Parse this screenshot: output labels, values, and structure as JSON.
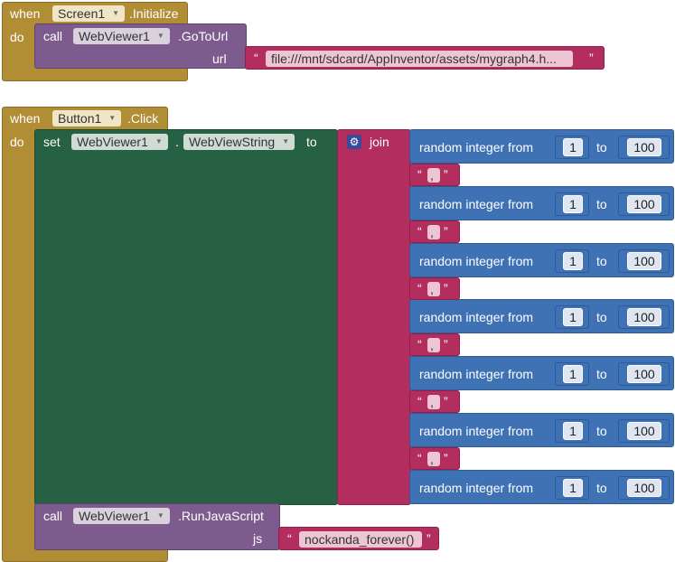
{
  "init_block": {
    "when": "when",
    "component": "Screen1",
    "event": ".Initialize",
    "do": "do",
    "call": "call",
    "target": "WebViewer1",
    "method": ".GoToUrl",
    "arg_label": "url",
    "url_value": "file:///mnt/sdcard/AppInventor/assets/mygraph4.h...",
    "open_quote": "“",
    "close_quote": "”"
  },
  "click_block": {
    "when": "when",
    "component": "Button1",
    "event": ".Click",
    "do": "do",
    "set": "set",
    "target": "WebViewer1",
    "dot": ".",
    "property": "WebViewString",
    "to": "to",
    "join": "join",
    "random_label": "random integer from",
    "from_value": "1",
    "to_label": "to",
    "to_value": "100",
    "separator": ",",
    "open_quote": "“",
    "close_quote": "”",
    "call": "call",
    "js_target": "WebViewer1",
    "js_method": ".RunJavaScript",
    "js_label": "js",
    "js_value": "nockanda_forever()"
  },
  "icons": {
    "dropdown": "dropdown-triangle-icon",
    "mutator": "gear-icon"
  }
}
